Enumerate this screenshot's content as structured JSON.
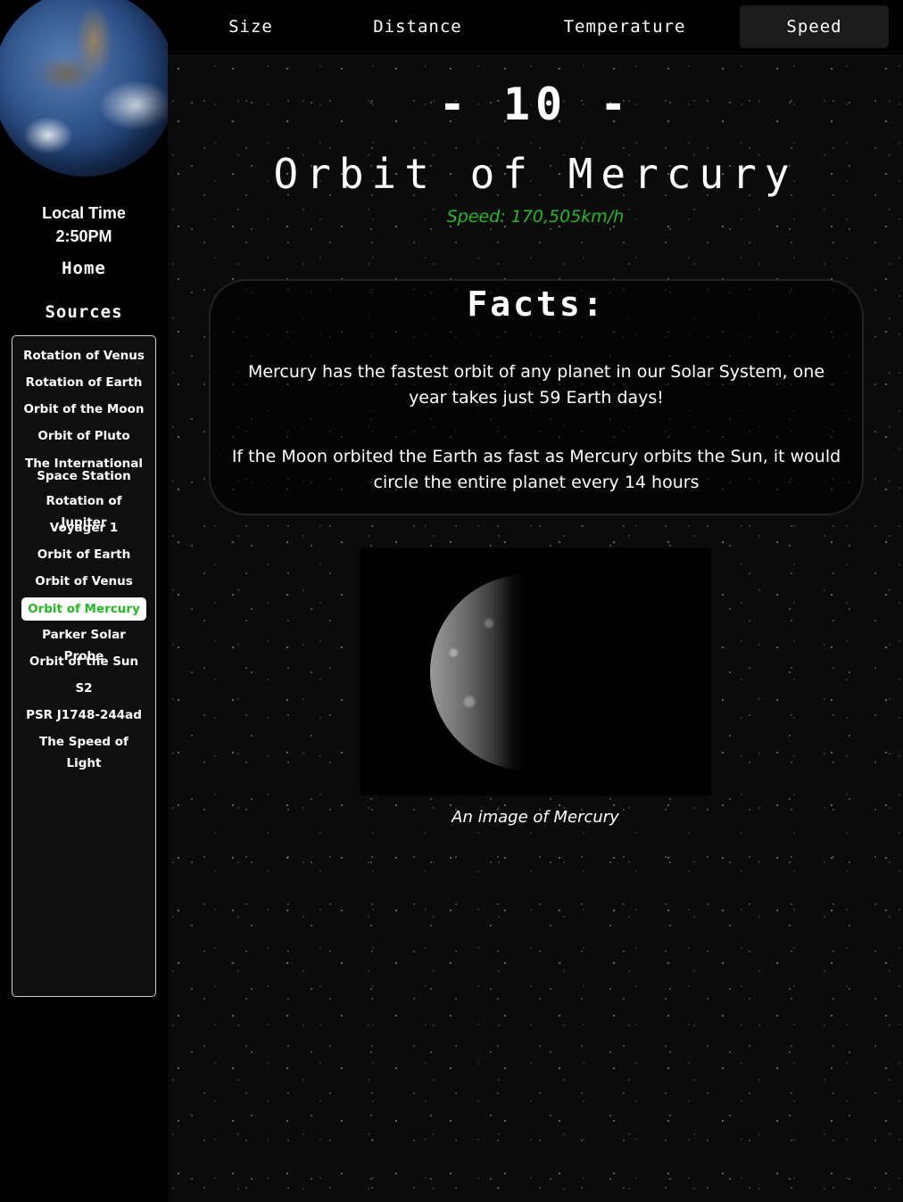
{
  "sidebar": {
    "local_time_label": "Local Time",
    "local_time_value": "2:50PM",
    "home": "Home",
    "sources": "Sources",
    "items": [
      {
        "label": "Rotation of Venus"
      },
      {
        "label": "Rotation of Earth"
      },
      {
        "label": "Orbit of the Moon"
      },
      {
        "label": "Orbit of Pluto"
      },
      {
        "label": "The International Space Station"
      },
      {
        "label": "Rotation of Jupiter"
      },
      {
        "label": "Voyager 1"
      },
      {
        "label": "Orbit of Earth"
      },
      {
        "label": "Orbit of Venus"
      },
      {
        "label": "Orbit of Mercury"
      },
      {
        "label": "Parker Solar Probe"
      },
      {
        "label": "Orbit of the Sun"
      },
      {
        "label": "S2"
      },
      {
        "label": "PSR J1748-244ad"
      },
      {
        "label": "The Speed of Light"
      }
    ],
    "active_item": "Orbit of Mercury"
  },
  "topnav": {
    "tabs": [
      {
        "label": "Size"
      },
      {
        "label": "Distance"
      },
      {
        "label": "Temperature"
      },
      {
        "label": "Speed"
      }
    ],
    "active_tab": "Speed"
  },
  "main": {
    "rank": "- 10 -",
    "title": "Orbit of Mercury",
    "speed": "Speed: 170,505km/h",
    "facts_heading": "Facts:",
    "facts": [
      "Mercury has the fastest orbit of any planet in our Solar System, one year takes just 59 Earth days!",
      "If the Moon orbited the Earth as fast as Mercury orbits the Sun, it would circle the entire planet every 14 hours"
    ],
    "caption": "An image of Mercury"
  },
  "colors": {
    "accent_green": "#22bb22",
    "background": "#000000"
  }
}
